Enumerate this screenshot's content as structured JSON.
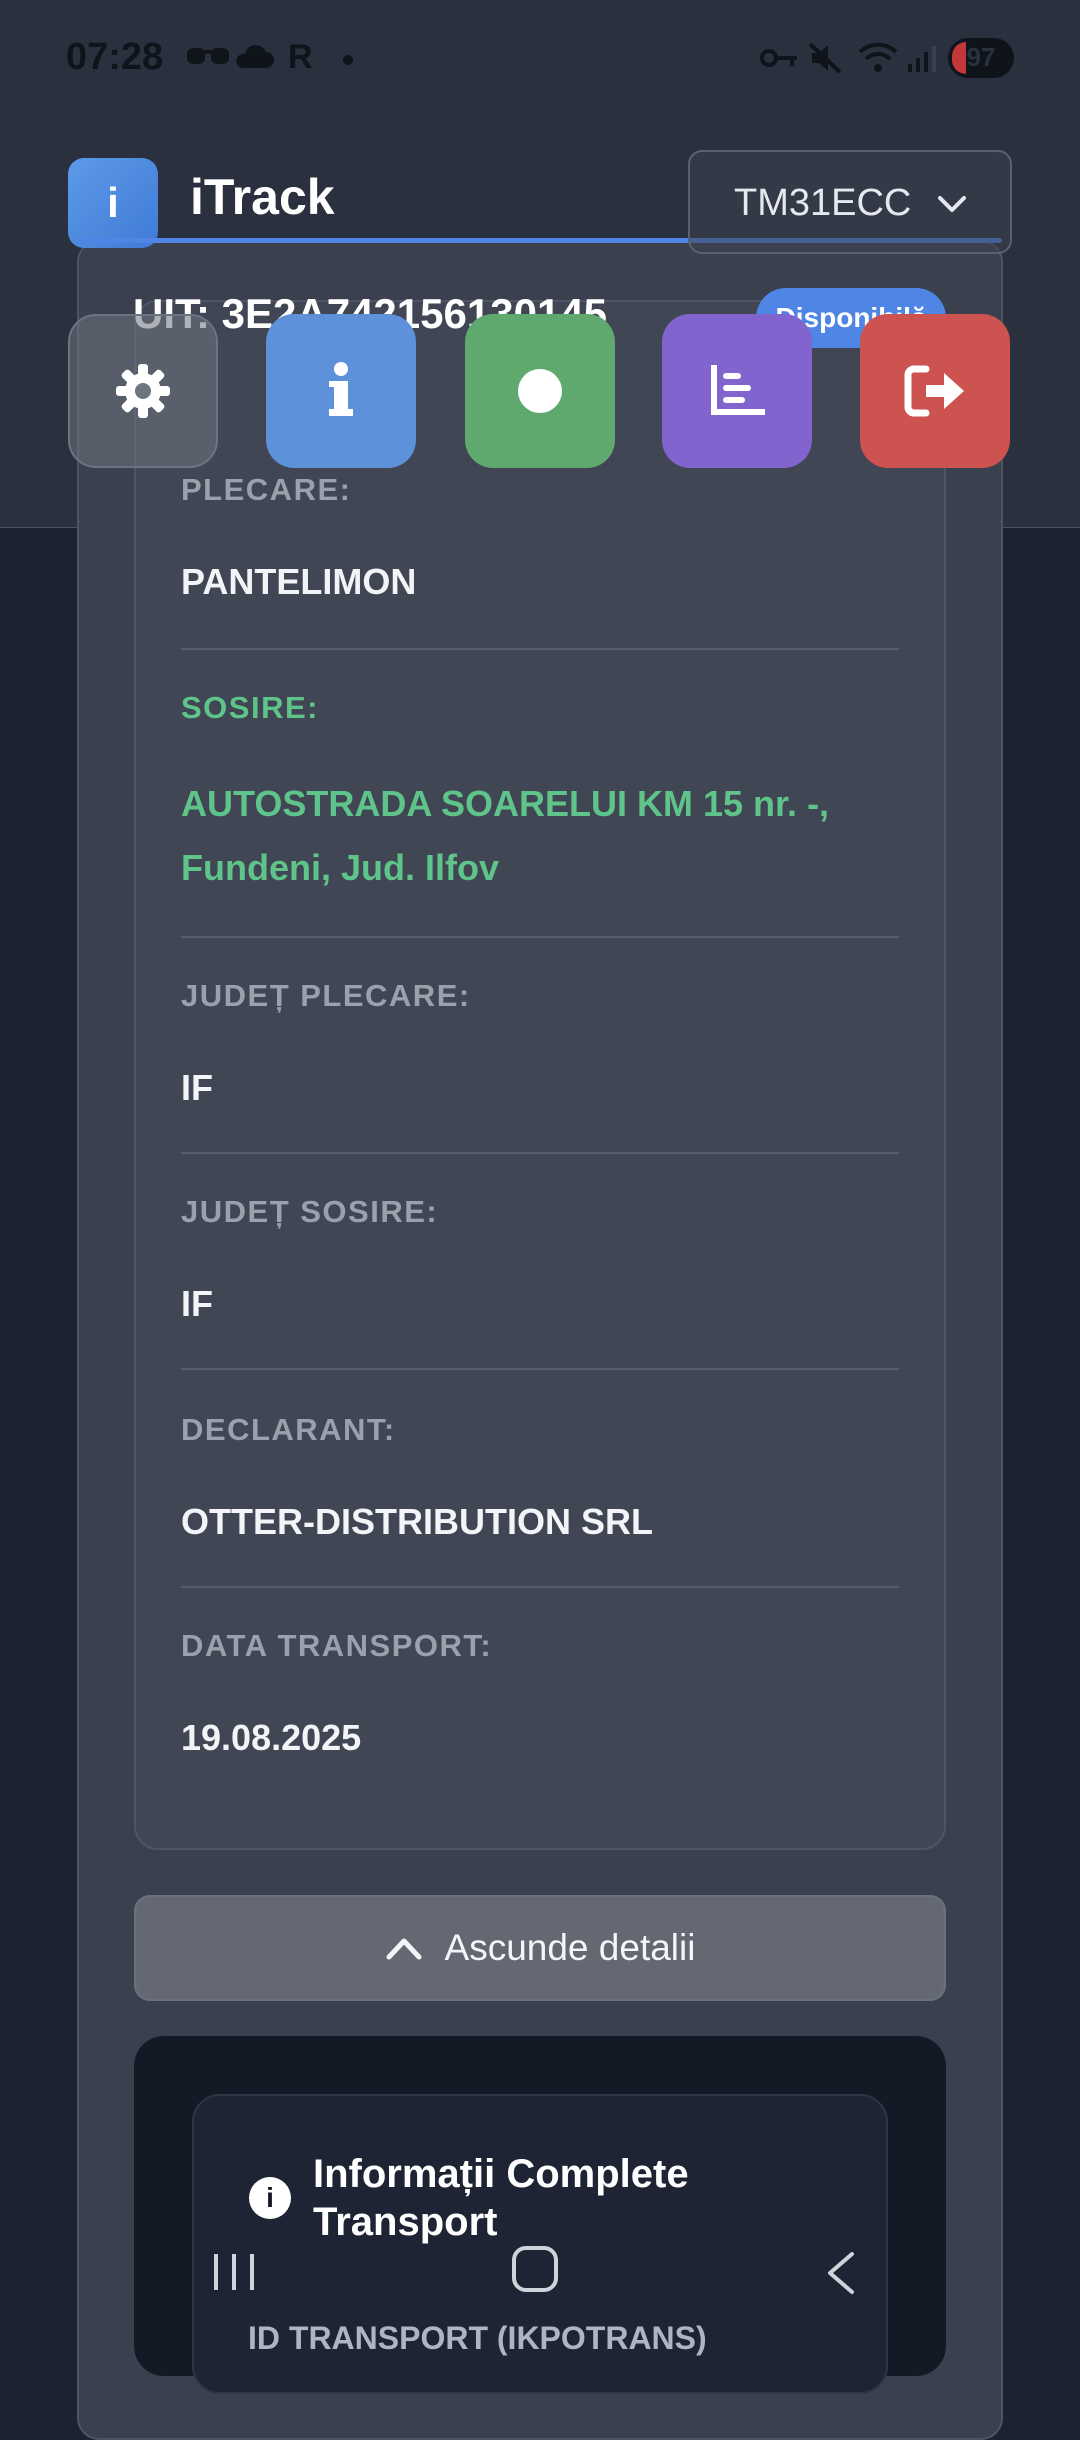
{
  "status_bar": {
    "time": "07:28",
    "icons": [
      "glasses-icon",
      "cloud-icon",
      "r-icon",
      "dot-icon",
      "key-icon",
      "mute-icon",
      "wifi-icon",
      "signal-icon"
    ],
    "battery": "97"
  },
  "header": {
    "logo_letter": "i",
    "app_name": "iTrack",
    "vehicle_select": "TM31ECC"
  },
  "transport": {
    "uit": "UIT: 3E2A742156130145",
    "status_badge": "Disponibilă"
  },
  "actions": [
    {
      "name": "settings",
      "icon": "gear-icon"
    },
    {
      "name": "info",
      "icon": "info-icon"
    },
    {
      "name": "record",
      "icon": "record-icon"
    },
    {
      "name": "stats",
      "icon": "chart-icon"
    },
    {
      "name": "logout",
      "icon": "logout-icon"
    }
  ],
  "details": {
    "plecare_label": "PLECARE:",
    "plecare_value": "PANTELIMON",
    "sosire_label": "SOSIRE:",
    "sosire_value": "AUTOSTRADA SOARELUI KM 15 nr. -, Fundeni, Jud. Ilfov",
    "judet_plecare_label": "JUDEȚ PLECARE:",
    "judet_plecare_value": "IF",
    "judet_sosire_label": "JUDEȚ SOSIRE:",
    "judet_sosire_value": "IF",
    "declarant_label": "DECLARANT:",
    "declarant_value": "OTTER-DISTRIBUTION SRL",
    "data_transport_label": "DATA TRANSPORT:",
    "data_transport_value": "19.08.2025"
  },
  "hide_button": "Ascunde detalii",
  "info_section": {
    "title": "Informații Complete Transport",
    "peek_text": "ID TRANSPORT (IKPOTRANS)"
  },
  "colors": {
    "accent": "#4f86e6",
    "green": "#5fc48a",
    "danger": "#cc534f",
    "purple": "#8264cf"
  }
}
